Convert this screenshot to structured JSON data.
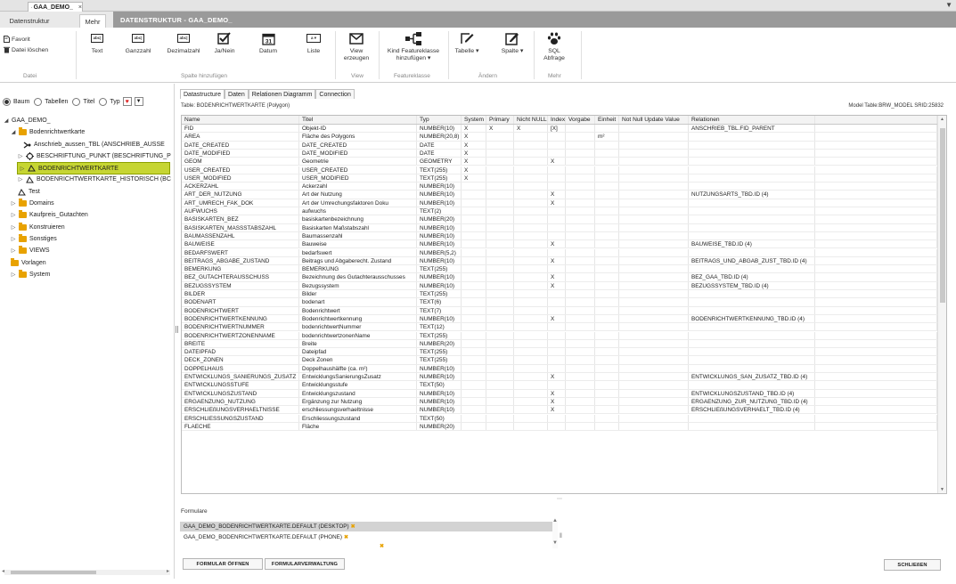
{
  "doc_tab": {
    "icon": "table-icon",
    "title": "GAA_DEMO_",
    "close": "×"
  },
  "window_menu": "▼",
  "ribbon_tabs": [
    {
      "label": "Datenstruktur"
    },
    {
      "label": "Mehr"
    }
  ],
  "context_title": "DATENSTRUKTUR - GAA_DEMO_",
  "ribbon": {
    "datei": {
      "favorit": "Favorit",
      "loeschen": "Datei löschen",
      "group": "Datei"
    },
    "spalte_buttons": [
      {
        "label": "Text",
        "icon": "abc-text-icon",
        "glyph": "abc|"
      },
      {
        "label": "Ganzzahl",
        "icon": "integer-icon",
        "glyph": "abc|"
      },
      {
        "label": "Dezimalzahl",
        "icon": "decimal-icon",
        "glyph": "abc|"
      },
      {
        "label": "Ja/Nein",
        "icon": "checkbox-icon"
      },
      {
        "label": "Datum",
        "icon": "calendar-icon",
        "glyph": "31"
      },
      {
        "label": "Liste",
        "icon": "list-icon",
        "glyph": "a ▾"
      }
    ],
    "spalte_group": "Spalte hinzufügen",
    "view_btn": "View erzeugen",
    "view_group": "View",
    "kind_btn": "Kind Featureklasse hinzufügen ▾",
    "feature_group": "Featureklasse",
    "tabelle_btn": "Tabelle ▾",
    "spalte_btn": "Spalte ▾",
    "aendern_group": "Ändern",
    "sql_btn": "SQL Abfrage",
    "mehr_group": "Mehr"
  },
  "filter": {
    "baum": "Baum",
    "tabellen": "Tabellen",
    "titel": "Titel",
    "typ": "Typ"
  },
  "tree": [
    {
      "label": "GAA_DEMO_",
      "arrow": "◢",
      "icon": "none"
    },
    {
      "label": "Bodenrichtwertkarte",
      "arrow": "◢",
      "icon": "folder-icon"
    },
    {
      "label": "Anschrieb_aussen_TBL (ANSCHRIEB_AUSSE",
      "arrow": "",
      "icon": "relation-icon"
    },
    {
      "label": "BESCHRIFTUNG_PUNKT (BESCHRIFTUNG_P",
      "arrow": "▷",
      "icon": "point-feature-icon"
    },
    {
      "label": "BODENRICHTWERTKARTE",
      "arrow": "▷",
      "icon": "polygon-feature-icon"
    },
    {
      "label": "BODENRICHTWERTKARTE_HISTORISCH (BC",
      "arrow": "▷",
      "icon": "polygon-feature-icon"
    },
    {
      "label": "Test",
      "arrow": "",
      "icon": "polygon-feature-icon"
    },
    {
      "label": "Domains",
      "arrow": "▷",
      "icon": "folder-icon"
    },
    {
      "label": "Kaufpreis_Gutachten",
      "arrow": "▷",
      "icon": "folder-icon"
    },
    {
      "label": "Konstruieren",
      "arrow": "▷",
      "icon": "folder-icon"
    },
    {
      "label": "Sonstiges",
      "arrow": "▷",
      "icon": "folder-icon"
    },
    {
      "label": "VIEWS",
      "arrow": "▷",
      "icon": "folder-icon"
    },
    {
      "label": "Vorlagen",
      "arrow": "",
      "icon": "folder-icon"
    },
    {
      "label": "System",
      "arrow": "▷",
      "icon": "system-folder-icon"
    }
  ],
  "ds_tabs": [
    {
      "label": "Datastructure"
    },
    {
      "label": "Daten"
    },
    {
      "label": "Relationen Diagramm"
    },
    {
      "label": "Connection"
    }
  ],
  "table_caption": "Table: BODENRICHTWERTKARTE (Polygon)",
  "model_caption": "Model Table:BRW_MODEL  SRID:25832",
  "columns": [
    "Name",
    "Titel",
    "Typ",
    "System",
    "Primary",
    "Nicht NULL",
    "Index",
    "Vorgabe",
    "Einheit",
    "Not Null Update Value",
    "Relationen"
  ],
  "rows": [
    [
      "FID",
      "Objekt-ID",
      "NUMBER(10)",
      "X",
      "X",
      "X",
      "[X]",
      "",
      "",
      "",
      "ANSCHRIEB_TBL.FID_PARENT"
    ],
    [
      "AREA",
      "Fläche des Polygons",
      "NUMBER(20,8)",
      "X",
      "",
      "",
      "",
      "",
      "m²",
      "",
      ""
    ],
    [
      "DATE_CREATED",
      "DATE_CREATED",
      "DATE",
      "X",
      "",
      "",
      "",
      "",
      "",
      "",
      ""
    ],
    [
      "DATE_MODIFIED",
      "DATE_MODIFIED",
      "DATE",
      "X",
      "",
      "",
      "",
      "",
      "",
      "",
      ""
    ],
    [
      "GEOM",
      "Geometrie",
      "GEOMETRY",
      "X",
      "",
      "",
      "X",
      "",
      "",
      "",
      ""
    ],
    [
      "USER_CREATED",
      "USER_CREATED",
      "TEXT(255)",
      "X",
      "",
      "",
      "",
      "",
      "",
      "",
      ""
    ],
    [
      "USER_MODIFIED",
      "USER_MODIFIED",
      "TEXT(255)",
      "X",
      "",
      "",
      "",
      "",
      "",
      "",
      ""
    ],
    [
      "ACKERZAHL",
      "Ackerzahl",
      "NUMBER(10)",
      "",
      "",
      "",
      "",
      "",
      "",
      "",
      ""
    ],
    [
      "ART_DER_NUTZUNG",
      "Art der Nutzung",
      "NUMBER(10)",
      "",
      "",
      "",
      "X",
      "",
      "",
      "",
      "NUTZUNGSARTS_TBD.ID (4)"
    ],
    [
      "ART_UMRECH_FAK_DOK",
      "Art der Umrechungsfaktoren Doku",
      "NUMBER(10)",
      "",
      "",
      "",
      "X",
      "",
      "",
      "",
      ""
    ],
    [
      "AUFWUCHS",
      "aufwuchs",
      "TEXT(2)",
      "",
      "",
      "",
      "",
      "",
      "",
      "",
      ""
    ],
    [
      "BASISKARTEN_BEZ",
      "basiskartenbezeichnung",
      "NUMBER(20)",
      "",
      "",
      "",
      "",
      "",
      "",
      "",
      ""
    ],
    [
      "BASISKARTEN_MASSSTABSZAHL",
      "Basiskarten Maßstabszahl",
      "NUMBER(10)",
      "",
      "",
      "",
      "",
      "",
      "",
      "",
      ""
    ],
    [
      "BAUMASSENZAHL",
      "Baumassenzahl",
      "NUMBER(10)",
      "",
      "",
      "",
      "",
      "",
      "",
      "",
      ""
    ],
    [
      "BAUWEISE",
      "Bauweise",
      "NUMBER(10)",
      "",
      "",
      "",
      "X",
      "",
      "",
      "",
      "BAUWEISE_TBD.ID (4)"
    ],
    [
      "BEDARFSWERT",
      "bedarfswert",
      "NUMBER(5,2)",
      "",
      "",
      "",
      "",
      "",
      "",
      "",
      ""
    ],
    [
      "BEITRAGS_ABGABE_ZUSTAND",
      "Beitrags und Abgaberecht. Zustand",
      "NUMBER(10)",
      "",
      "",
      "",
      "X",
      "",
      "",
      "",
      "BEITRAGS_UND_ABGAB_ZUST_TBD.ID (4)"
    ],
    [
      "BEMERKUNG",
      "BEMERKUNG",
      "TEXT(255)",
      "",
      "",
      "",
      "",
      "",
      "",
      "",
      ""
    ],
    [
      "BEZ_GUTACHTERAUSSCHUSS",
      "Bezeichnung des Gutachterausschusses",
      "NUMBER(10)",
      "",
      "",
      "",
      "X",
      "",
      "",
      "",
      "BEZ_GAA_TBD.ID (4)"
    ],
    [
      "BEZUGSSYSTEM",
      "Bezugssystem",
      "NUMBER(10)",
      "",
      "",
      "",
      "X",
      "",
      "",
      "",
      "BEZUGSSYSTEM_TBD.ID (4)"
    ],
    [
      "BILDER",
      "Bilder",
      "TEXT(255)",
      "",
      "",
      "",
      "",
      "",
      "",
      "",
      ""
    ],
    [
      "BODENART",
      "bodenart",
      "TEXT(6)",
      "",
      "",
      "",
      "",
      "",
      "",
      "",
      ""
    ],
    [
      "BODENRICHTWERT",
      "Bodenrichtwert",
      "TEXT(7)",
      "",
      "",
      "",
      "",
      "",
      "",
      "",
      ""
    ],
    [
      "BODENRICHTWERTKENNUNG",
      "Bodenrichtwertkennung",
      "NUMBER(10)",
      "",
      "",
      "",
      "X",
      "",
      "",
      "",
      "BODENRICHTWERTKENNUNG_TBD.ID (4)"
    ],
    [
      "BODENRICHTWERTNUMMER",
      "bodenrichtwertNummer",
      "TEXT(12)",
      "",
      "",
      "",
      "",
      "",
      "",
      "",
      ""
    ],
    [
      "BODENRICHTWERTZONENNAME",
      "bodenrichtwertzonenName",
      "TEXT(255)",
      "",
      "",
      "",
      "",
      "",
      "",
      "",
      ""
    ],
    [
      "BREITE",
      "Breite",
      "NUMBER(20)",
      "",
      "",
      "",
      "",
      "",
      "",
      "",
      ""
    ],
    [
      "DATEIPFAD",
      "Dateipfad",
      "TEXT(255)",
      "",
      "",
      "",
      "",
      "",
      "",
      "",
      ""
    ],
    [
      "DECK_ZONEN",
      "Deck Zonen",
      "TEXT(255)",
      "",
      "",
      "",
      "",
      "",
      "",
      "",
      ""
    ],
    [
      "DOPPELHAUS",
      "Doppelhaushälfte (ca. m²)",
      "NUMBER(10)",
      "",
      "",
      "",
      "",
      "",
      "",
      "",
      ""
    ],
    [
      "ENTWICKLUNGS_SANIERUNGS_ZUSATZ",
      "EntwicklungsSanierungsZusatz",
      "NUMBER(10)",
      "",
      "",
      "",
      "X",
      "",
      "",
      "",
      "ENTWICKLUNGS_SAN_ZUSATZ_TBD.ID (4)"
    ],
    [
      "ENTWICKLUNGSSTUFE",
      "Entwicklungsstufe",
      "TEXT(50)",
      "",
      "",
      "",
      "",
      "",
      "",
      "",
      ""
    ],
    [
      "ENTWICKLUNGSZUSTAND",
      "Entwicklungszustand",
      "NUMBER(10)",
      "",
      "",
      "",
      "X",
      "",
      "",
      "",
      "ENTWICKLUNGSZUSTAND_TBD.ID (4)"
    ],
    [
      "ERGAENZUNG_NUTZUNG",
      "Ergänzung zur Nutzung",
      "NUMBER(10)",
      "",
      "",
      "",
      "X",
      "",
      "",
      "",
      "ERGAENZUNG_ZUR_NUTZUNG_TBD.ID (4)"
    ],
    [
      "ERSCHLIEßUNGSVERHAELTNISSE",
      "erschliessungsverhaeltnisse",
      "NUMBER(10)",
      "",
      "",
      "",
      "X",
      "",
      "",
      "",
      "ERSCHLIEßUNGSVERHAELT_TBD.ID (4)"
    ],
    [
      "ERSCHLIESSUNGSZUSTAND",
      "Erschliessungszustand",
      "TEXT(50)",
      "",
      "",
      "",
      "",
      "",
      "",
      "",
      ""
    ],
    [
      "FLAECHE",
      "Fläche",
      "NUMBER(20)",
      "",
      "",
      "",
      "",
      "",
      "",
      "",
      ""
    ]
  ],
  "formulare_label": "Formulare",
  "forms": [
    {
      "label": "GAA_DEMO_BODENRICHTWERTKARTE.DEFAULT (DESKTOP)",
      "icon": "excel-icon"
    },
    {
      "label": "GAA_DEMO_BODENRICHTWERTKARTE.DEFAULT (PHONE)",
      "icon": "excel-icon"
    },
    {
      "label": "",
      "icon": "excel-icon"
    }
  ],
  "buttons": {
    "open": "FORMULAR ÖFFNEN",
    "manage": "FORMULARVERWALTUNG",
    "close": "SCHLIEßEN"
  }
}
